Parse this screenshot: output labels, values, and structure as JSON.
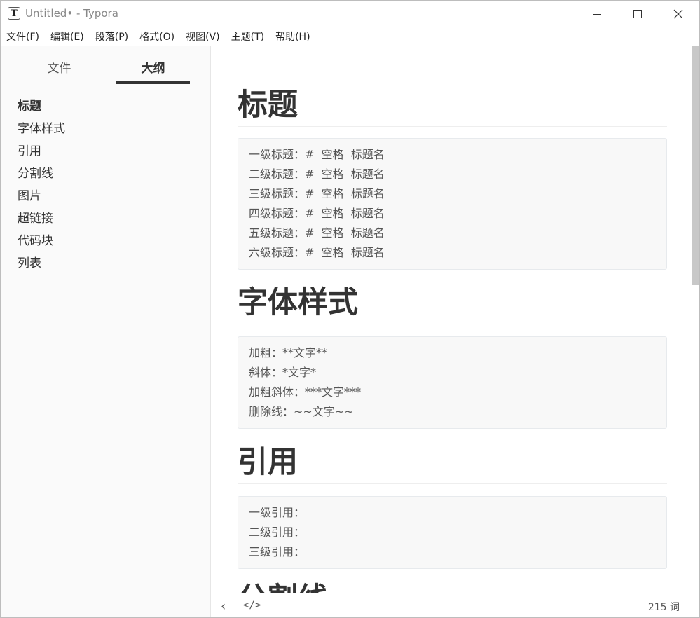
{
  "window": {
    "app_icon": "T",
    "title": "Untitled• - Typora",
    "icons": [
      "minimize-icon",
      "maximize-icon",
      "close-icon"
    ]
  },
  "menu": [
    "文件(F)",
    "编辑(E)",
    "段落(P)",
    "格式(O)",
    "视图(V)",
    "主题(T)",
    "帮助(H)"
  ],
  "sidebar": {
    "tabs": [
      {
        "label": "文件"
      },
      {
        "label": "大纲"
      }
    ],
    "active_tab": "大纲",
    "outline": [
      "标题",
      "字体样式",
      "引用",
      "分割线",
      "图片",
      "超链接",
      "代码块",
      "列表"
    ],
    "active_outline": "标题"
  },
  "editor": {
    "sections": [
      {
        "heading": "标题",
        "code_lines": [
          "一级标题：#  空格  标题名",
          "二级标题：#  空格  标题名",
          "三级标题：#  空格  标题名",
          "四级标题：#  空格  标题名",
          "五级标题：#  空格  标题名",
          "六级标题：#  空格  标题名"
        ]
      },
      {
        "heading": "字体样式",
        "code_lines": [
          "加粗：**文字**",
          "斜体：*文字*",
          "加粗斜体：***文字***",
          "删除线：~~文字~~"
        ]
      },
      {
        "heading": "引用",
        "code_lines": [
          "一级引用：",
          "二级引用：",
          "三级引用："
        ]
      },
      {
        "heading": "分割线",
        "code_lines": []
      }
    ]
  },
  "statusbar": {
    "back_icon": "‹",
    "source_icon": "</>",
    "word_count": "215 词"
  }
}
